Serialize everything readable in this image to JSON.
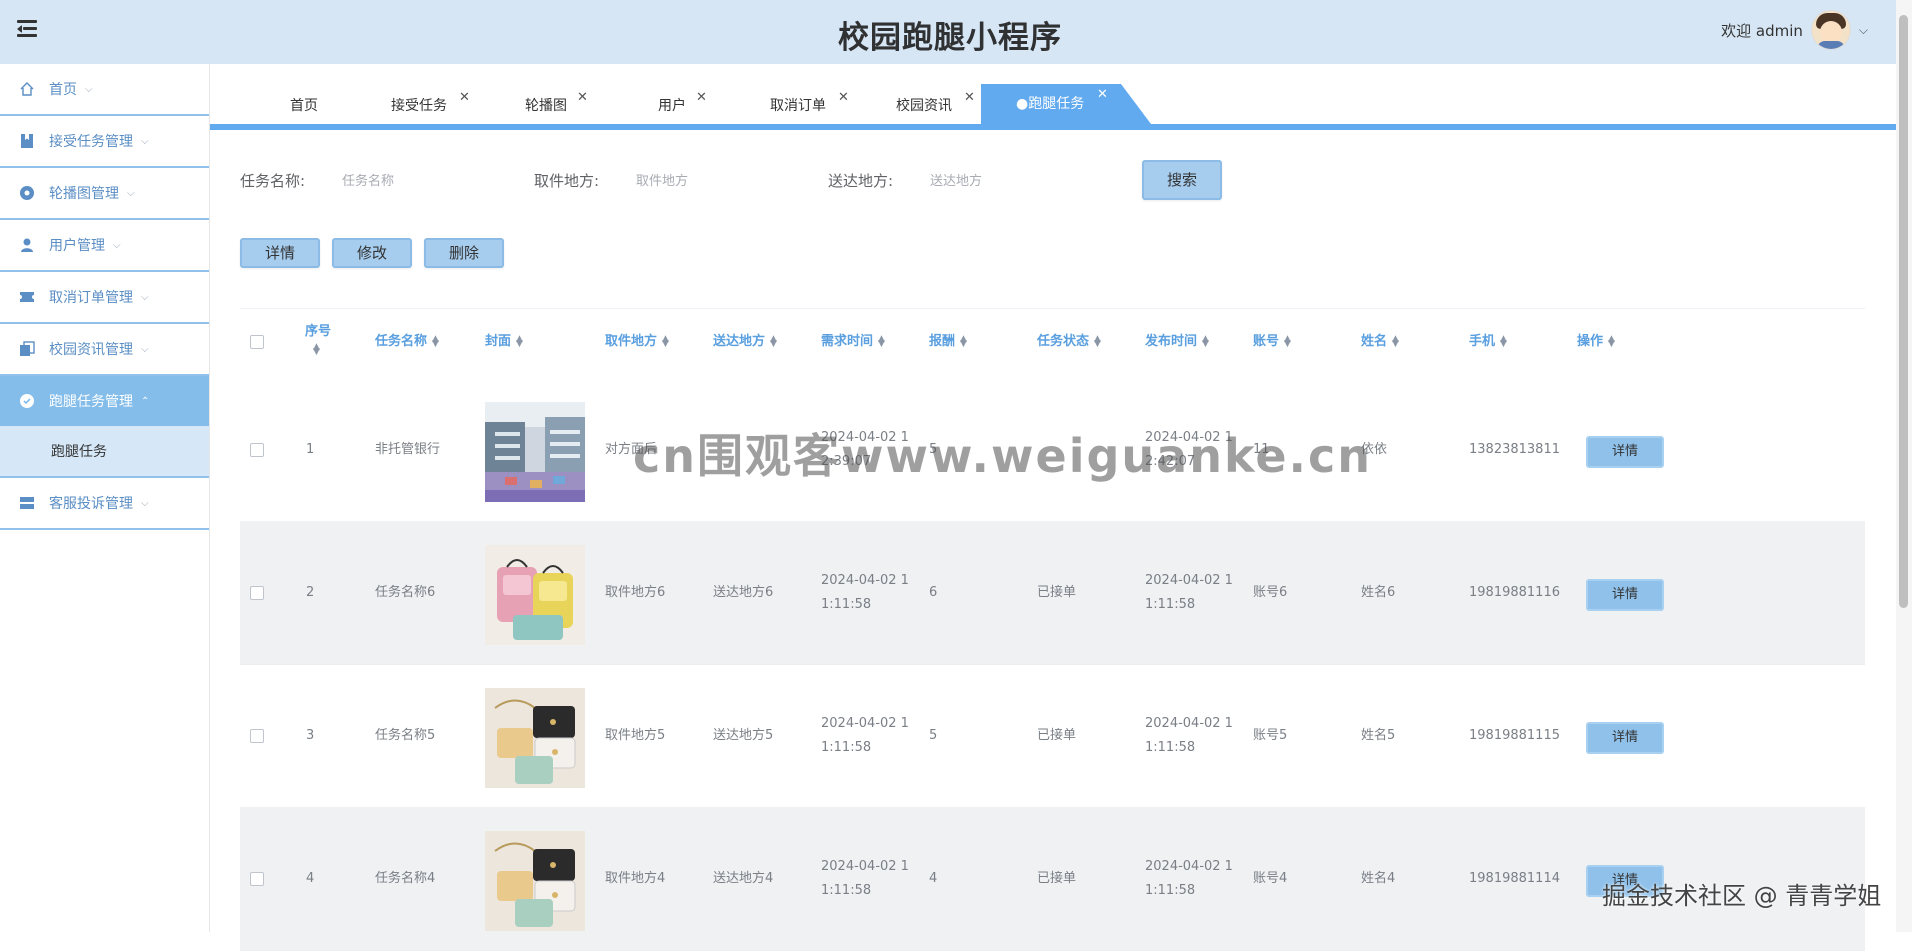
{
  "header": {
    "title": "校园跑腿小程序",
    "welcome": "欢迎 admin"
  },
  "sidebar": {
    "items": [
      {
        "label": "首页",
        "icon": "home-icon"
      },
      {
        "label": "接受任务管理",
        "icon": "bookmark-icon"
      },
      {
        "label": "轮播图管理",
        "icon": "circle-dot-icon"
      },
      {
        "label": "用户管理",
        "icon": "user-icon"
      },
      {
        "label": "取消订单管理",
        "icon": "ticket-icon"
      },
      {
        "label": "校园资讯管理",
        "icon": "documents-icon"
      },
      {
        "label": "跑腿任务管理",
        "icon": "check-circle-icon",
        "active": true
      },
      {
        "label": "客服投诉管理",
        "icon": "stack-icon"
      }
    ],
    "subitem": "跑腿任务"
  },
  "tabs": [
    {
      "label": "首页"
    },
    {
      "label": "接受任务"
    },
    {
      "label": "轮播图"
    },
    {
      "label": "用户"
    },
    {
      "label": "取消订单"
    },
    {
      "label": "校园资讯"
    },
    {
      "label": "●跑腿任务",
      "active": true
    }
  ],
  "search": {
    "task_name_label": "任务名称:",
    "task_name_placeholder": "任务名称",
    "pickup_label": "取件地方:",
    "pickup_placeholder": "取件地方",
    "delivery_label": "送达地方:",
    "delivery_placeholder": "送达地方",
    "button": "搜索"
  },
  "actions": {
    "detail": "详情",
    "edit": "修改",
    "delete": "删除"
  },
  "table": {
    "headers": [
      "序号",
      "任务名称",
      "封面",
      "取件地方",
      "送达地方",
      "需求时间",
      "报酬",
      "任务状态",
      "发布时间",
      "账号",
      "姓名",
      "手机",
      "操作"
    ],
    "rows": [
      {
        "no": "1",
        "name": "非托管银行",
        "pickup": "对方面后",
        "delivery": "",
        "need_time_1": "2024-04-02 1",
        "need_time_2": "2:39:07",
        "reward": "5",
        "status": "",
        "pub_time_1": "2024-04-02 1",
        "pub_time_2": "2:42:07",
        "account": "11",
        "person": "依依",
        "phone": "13823813811",
        "op": "详情"
      },
      {
        "no": "2",
        "name": "任务名称6",
        "pickup": "取件地方6",
        "delivery": "送达地方6",
        "need_time_1": "2024-04-02 1",
        "need_time_2": "1:11:58",
        "reward": "6",
        "status": "已接单",
        "pub_time_1": "2024-04-02 1",
        "pub_time_2": "1:11:58",
        "account": "账号6",
        "person": "姓名6",
        "phone": "19819881116",
        "op": "详情"
      },
      {
        "no": "3",
        "name": "任务名称5",
        "pickup": "取件地方5",
        "delivery": "送达地方5",
        "need_time_1": "2024-04-02 1",
        "need_time_2": "1:11:58",
        "reward": "5",
        "status": "已接单",
        "pub_time_1": "2024-04-02 1",
        "pub_time_2": "1:11:58",
        "account": "账号5",
        "person": "姓名5",
        "phone": "19819881115",
        "op": "详情"
      },
      {
        "no": "4",
        "name": "任务名称4",
        "pickup": "取件地方4",
        "delivery": "送达地方4",
        "need_time_1": "2024-04-02 1",
        "need_time_2": "1:11:58",
        "reward": "4",
        "status": "已接单",
        "pub_time_1": "2024-04-02 1",
        "pub_time_2": "1:11:58",
        "account": "账号4",
        "person": "姓名4",
        "phone": "19819881114",
        "op": "详情"
      }
    ]
  },
  "watermarks": {
    "center": "cn围观客www.weiguanke.cn",
    "corner": "掘金技术社区 @ 青青学姐"
  }
}
